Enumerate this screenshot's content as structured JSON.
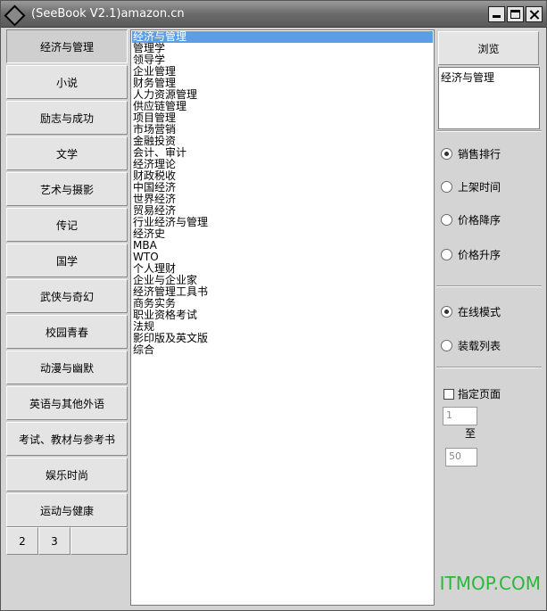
{
  "window": {
    "title": "(SeeBook V2.1)amazon.cn"
  },
  "categories": [
    "经济与管理",
    "小说",
    "励志与成功",
    "文学",
    "艺术与摄影",
    "传记",
    "国学",
    "武侠与奇幻",
    "校园青春",
    "动漫与幽默",
    "英语与其他外语",
    "考试、教材与参考书",
    "娱乐时尚",
    "运动与健康"
  ],
  "pages": [
    "2",
    "3"
  ],
  "subcategories": [
    "经济与管理",
    "管理学",
    "领导学",
    "企业管理",
    "财务管理",
    "人力资源管理",
    "供应链管理",
    "项目管理",
    "市场营销",
    "金融投资",
    "会计、审计",
    "经济理论",
    "财政税收",
    "中国经济",
    "世界经济",
    "贸易经济",
    "行业经济与管理",
    "经济史",
    "MBA",
    "WTO",
    "个人理财",
    "企业与企业家",
    "经济管理工具书",
    "商务实务",
    "职业资格考试",
    "法规",
    "影印版及英文版",
    "综合"
  ],
  "right": {
    "browse_label": "浏览",
    "current_category": "经济与管理",
    "sort_options": [
      "销售排行",
      "上架时间",
      "价格降序",
      "价格升序"
    ],
    "mode_options": [
      "在线模式",
      "装载列表"
    ],
    "page_check_label": "指定页面",
    "from_value": "1",
    "to_label": "至",
    "to_value": "50"
  },
  "watermark": "ITMOP.COM"
}
